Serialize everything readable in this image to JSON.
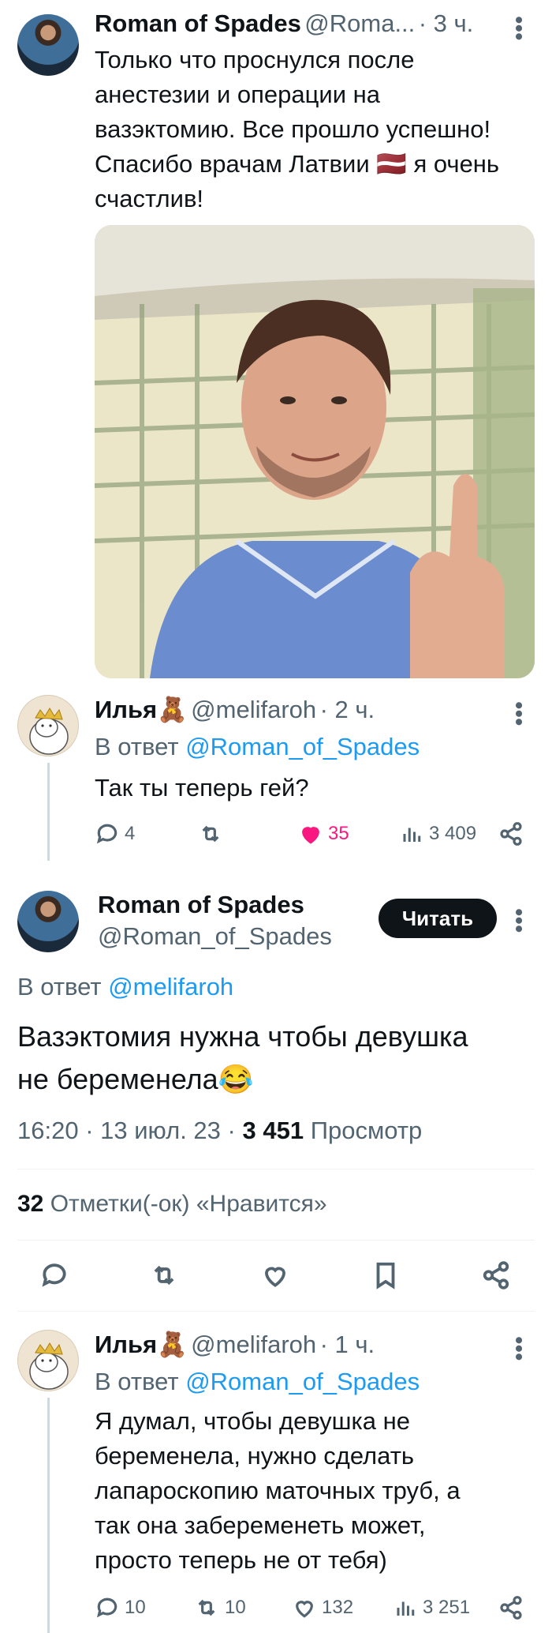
{
  "tweet1": {
    "author_name": "Roman of Spades",
    "author_handle": "@Roma...",
    "time": "· 3 ч.",
    "text_lines": [
      "Только что проснулся после",
      "анестезии и операции на",
      "вазэктомию. Все прошло успешно!",
      "Спасибо врачам Латвии 🇱🇻 я очень",
      "счастлив!"
    ]
  },
  "reply1": {
    "author_name": "Илья🧸",
    "author_handle": "@melifaroh",
    "time": "· 2 ч.",
    "reply_to_prefix": "В ответ ",
    "reply_to_handle": "@Roman_of_Spades",
    "text": "Так ты теперь гей?",
    "replies": "4",
    "retweets": "",
    "likes": "35",
    "views": "3 409",
    "like_color": "#f91880"
  },
  "main": {
    "author_name": "Roman of Spades",
    "author_handle": "@Roman_of_Spades",
    "follow_label": "Читать",
    "reply_to_prefix": "В ответ ",
    "reply_to_handle": "@melifaroh",
    "text_lines": [
      "Вазэктомия нужна чтобы девушка",
      "не беременела😂"
    ],
    "time": "16:20",
    "date": "13 июл. 23",
    "views_count": "3 451",
    "views_label": "Просмотр",
    "likes_count": "32",
    "likes_label": "Отметки(-ок) «Нравится»"
  },
  "reply2": {
    "author_name": "Илья🧸",
    "author_handle": "@melifaroh",
    "time": "· 1 ч.",
    "reply_to_prefix": "В ответ ",
    "reply_to_handle": "@Roman_of_Spades",
    "text_lines": [
      "Я думал, чтобы девушка не",
      "беременела, нужно сделать",
      "лапароскопию маточных труб, а",
      "так она забеременеть может,",
      "просто теперь не от тебя)"
    ],
    "replies": "10",
    "retweets": "10",
    "likes": "132",
    "views": "3 251"
  },
  "colors": {
    "accent": "#1d9bf0",
    "text": "#0f1419",
    "secondary": "#536471"
  },
  "icons": [
    "reply-icon",
    "retweet-icon",
    "like-icon",
    "views-icon",
    "share-icon",
    "bookmark-icon",
    "more-icon"
  ]
}
